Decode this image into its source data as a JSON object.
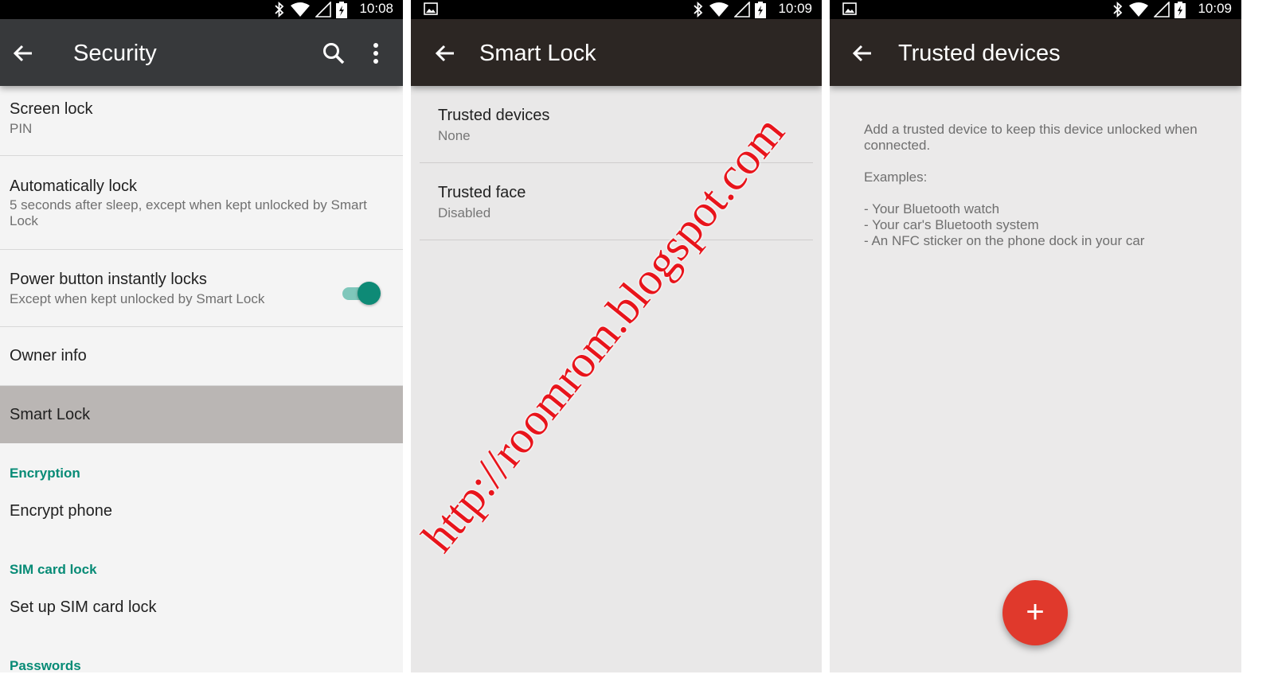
{
  "panels": [
    {
      "statusbar": {
        "time": "10:08"
      },
      "toolbar": {
        "title": "Security"
      },
      "items": {
        "screen_lock": {
          "title": "Screen lock",
          "summary": "PIN"
        },
        "auto_lock": {
          "title": "Automatically lock",
          "summary": "5 seconds after sleep, except when kept unlocked by Smart Lock"
        },
        "power_button": {
          "title": "Power button instantly locks",
          "summary": "Except when kept unlocked by Smart Lock",
          "toggle_on": true
        },
        "owner_info": {
          "title": "Owner info"
        },
        "smart_lock": {
          "title": "Smart Lock"
        },
        "encryption_header": "Encryption",
        "encrypt_phone": "Encrypt phone",
        "sim_header": "SIM card lock",
        "sim_setup": "Set up SIM card lock",
        "passwords_header": "Passwords"
      }
    },
    {
      "statusbar": {
        "time": "10:09"
      },
      "toolbar": {
        "title": "Smart Lock"
      },
      "items": {
        "trusted_devices": {
          "title": "Trusted devices",
          "summary": "None"
        },
        "trusted_face": {
          "title": "Trusted face",
          "summary": "Disabled"
        }
      }
    },
    {
      "statusbar": {
        "time": "10:09"
      },
      "toolbar": {
        "title": "Trusted devices"
      },
      "body": {
        "intro": "Add a trusted device to keep this device unlocked when connected.",
        "examples_label": "Examples:",
        "example_1": "- Your Bluetooth watch",
        "example_2": "- Your car's Bluetooth system",
        "example_3": "- An NFC sticker on the phone dock in your car"
      },
      "fab_label": "+"
    }
  ],
  "watermark": "http://roomrom.blogspot.com",
  "colors": {
    "accent_teal": "#078b76",
    "fab_red": "#e0392c",
    "watermark_red": "#e8141b",
    "selected_row": "#bab6b4"
  },
  "icons": [
    "back-arrow-icon",
    "search-icon",
    "more-vert-icon",
    "bluetooth-icon",
    "wifi-icon",
    "cell-signal-icon",
    "battery-charging-icon",
    "gallery-icon"
  ]
}
